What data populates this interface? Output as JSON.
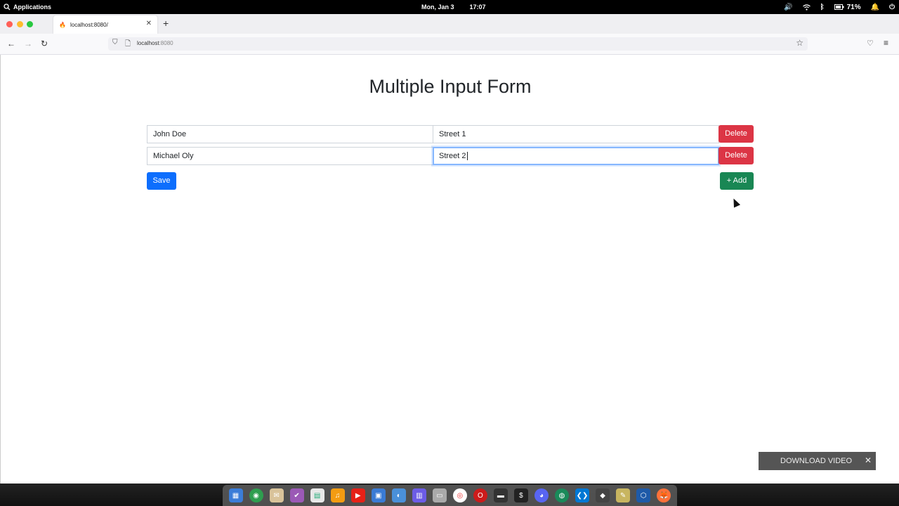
{
  "system_bar": {
    "apps_label": "Applications",
    "date": "Mon, Jan 3",
    "time": "17:07",
    "battery": "71%"
  },
  "browser": {
    "tab_title": "localhost:8080/",
    "url_host": "localhost",
    "url_port": ":8080"
  },
  "page": {
    "title": "Multiple Input Form",
    "rows": [
      {
        "name": "John Doe",
        "address": "Street 1",
        "delete_label": "Delete"
      },
      {
        "name": "Michael Oly",
        "address": "Street 2",
        "delete_label": "Delete"
      }
    ],
    "save_label": "Save",
    "add_label": "+ Add"
  },
  "overlay": {
    "download_label": "DOWNLOAD VIDEO",
    "close_glyph": "✕"
  },
  "colors": {
    "danger": "#dc3545",
    "primary": "#0d6efd",
    "success": "#198754"
  },
  "dock_icons": [
    "workspace-icon",
    "browser-icon",
    "mail-icon",
    "tasks-icon",
    "spreadsheet-icon",
    "music-icon",
    "youtube-icon",
    "image-viewer-icon",
    "toggle-icon",
    "calendar-icon",
    "files-icon",
    "chrome-icon",
    "opera-icon",
    "monitor-icon",
    "terminal-icon",
    "discord-icon",
    "globe-icon",
    "vscode-icon",
    "inkscape-icon",
    "notes-icon",
    "virtualbox-icon",
    "firefox-icon"
  ]
}
